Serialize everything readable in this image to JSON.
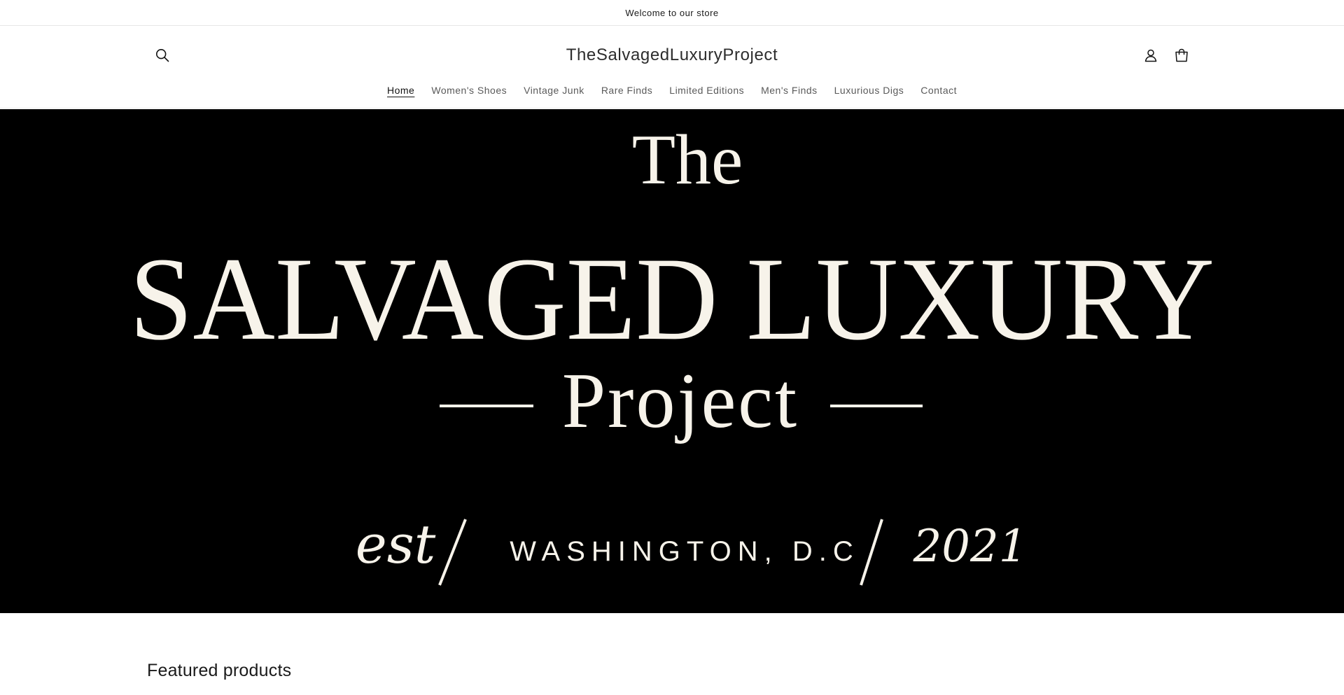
{
  "announcement": {
    "text": "Welcome to our store"
  },
  "header": {
    "site_title": "TheSalvagedLuxuryProject",
    "icons": {
      "search": "search-icon",
      "account": "user-icon",
      "cart": "cart-icon"
    }
  },
  "nav": {
    "items": [
      {
        "label": "Home",
        "active": true
      },
      {
        "label": "Women's Shoes",
        "active": false
      },
      {
        "label": "Vintage Junk",
        "active": false
      },
      {
        "label": "Rare Finds",
        "active": false
      },
      {
        "label": "Limited Editions",
        "active": false
      },
      {
        "label": "Men's Finds",
        "active": false
      },
      {
        "label": "Luxurious Digs",
        "active": false
      },
      {
        "label": "Contact",
        "active": false
      }
    ]
  },
  "hero": {
    "line1": "The",
    "line2": "SALVAGED LUXURY",
    "line3": "Project",
    "est": "est",
    "city": "WASHINGTON, D.C",
    "year": "2021",
    "text_color": "#f7f3ea",
    "background": "#000000"
  },
  "featured": {
    "heading": "Featured products"
  }
}
